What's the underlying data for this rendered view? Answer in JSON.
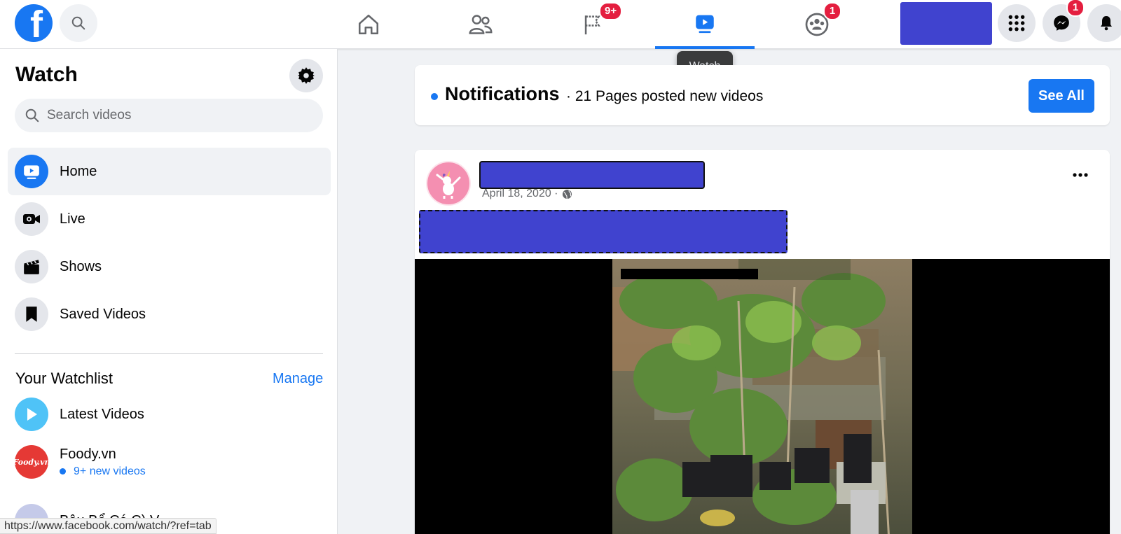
{
  "topbar": {
    "logo_letter": "f",
    "nav": [
      {
        "name": "home",
        "badge": ""
      },
      {
        "name": "friends",
        "badge": ""
      },
      {
        "name": "pages",
        "badge": "9+"
      },
      {
        "name": "watch",
        "badge": ""
      },
      {
        "name": "groups",
        "badge": "1"
      }
    ],
    "messenger_badge": "1",
    "tooltip": "Watch"
  },
  "sidebar": {
    "title": "Watch",
    "search_placeholder": "Search videos",
    "items": [
      {
        "label": "Home",
        "icon": "watch-home-icon",
        "active": true
      },
      {
        "label": "Live",
        "icon": "live-camera-icon",
        "active": false
      },
      {
        "label": "Shows",
        "icon": "clapperboard-icon",
        "active": false
      },
      {
        "label": "Saved Videos",
        "icon": "bookmark-icon",
        "active": false
      }
    ],
    "watchlist_title": "Your Watchlist",
    "manage_label": "Manage",
    "watchlist": [
      {
        "name": "Latest Videos",
        "sub": ""
      },
      {
        "name": "Foody.vn",
        "sub": "9+ new videos",
        "avatar_text": "Foody.vn"
      }
    ],
    "partial_item": "Bâu Bổ Cá C) V..."
  },
  "status_url": "https://www.facebook.com/watch/?ref=tab",
  "notifications": {
    "title": "Notifications",
    "subtitle": "· 21 Pages posted new videos",
    "see_all": "See All"
  },
  "post": {
    "date": "April 18, 2020 ·",
    "privacy_icon": "globe-icon",
    "more_icon": "more-dots-icon"
  },
  "colors": {
    "brand": "#1877f2",
    "badge": "#e41e3f",
    "redaction": "#4043cf"
  }
}
